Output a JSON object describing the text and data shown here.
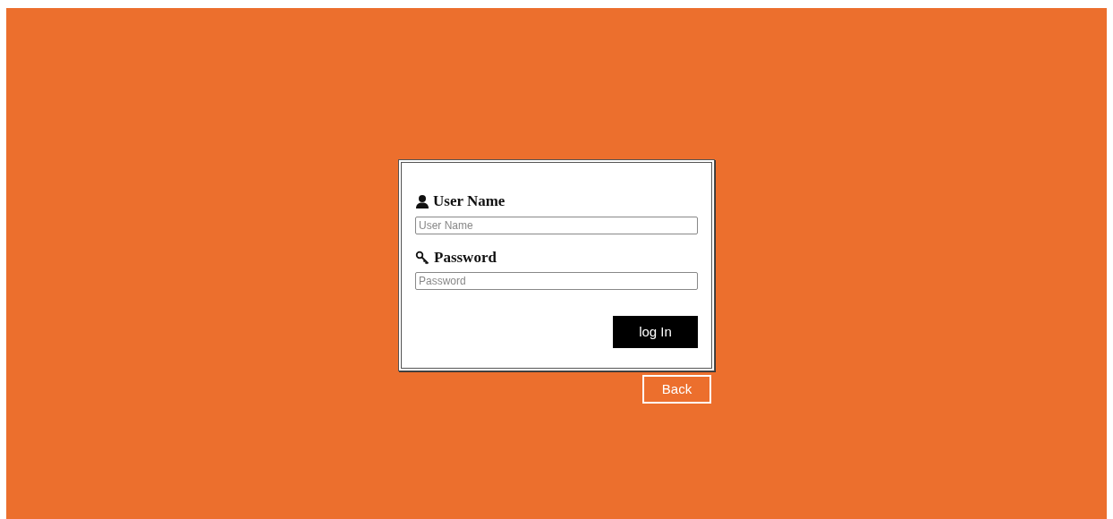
{
  "form": {
    "fields": [
      {
        "kind": "user",
        "label": "User Name",
        "placeholder": "User Name"
      },
      {
        "kind": "key",
        "label": "Password",
        "placeholder": "Password"
      }
    ],
    "submit": "log In"
  },
  "back": "Back"
}
